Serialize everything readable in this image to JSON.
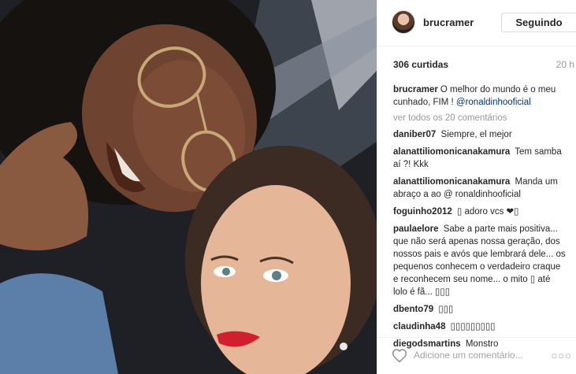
{
  "post": {
    "username": "brucramer",
    "follow_label": "Seguindo",
    "likes": "306 curtidas",
    "time": "20 h",
    "view_all": "ver todos os 20 comentários",
    "caption": {
      "user": "brucramer",
      "text": "O melhor do mundo é o meu cunhado, FIM ! ",
      "mention": "@ronaldinhooficial"
    },
    "comments": [
      {
        "user": "daniber07",
        "text": "Siempre, el mejor"
      },
      {
        "user": "alanattiliomonicanakamura",
        "text": "Tem samba aí ?! Kkk"
      },
      {
        "user": "alanattiliomonicanakamura",
        "text": "Manda um abraço a ao @ ronaldinhooficial"
      },
      {
        "user": "foguinho2012",
        "text": "▯ adoro vcs ❤▯"
      },
      {
        "user": "paulaelore",
        "text": "Sabe a parte mais positiva... que não será apenas nossa geração, dos nossos pais e avós que lembrará dele... os pequenos conhecem o verdadeiro craque e reconhecem seu nome... o mito ▯ até lolo é fã... ▯▯▯"
      },
      {
        "user": "dbento79",
        "text": "▯▯▯"
      },
      {
        "user": "claudinha48",
        "text": "▯▯▯▯▯▯▯▯▯"
      },
      {
        "user": "diegodsmartins",
        "text": "Monstro"
      }
    ],
    "add_comment_placeholder": "Adicione um comentário...",
    "more_label": "○○○",
    "icons": {
      "like": "heart-icon",
      "more": "more-options-icon"
    },
    "colors": {
      "link": "#003569",
      "muted": "#999999",
      "border": "#dbdbdb"
    }
  }
}
